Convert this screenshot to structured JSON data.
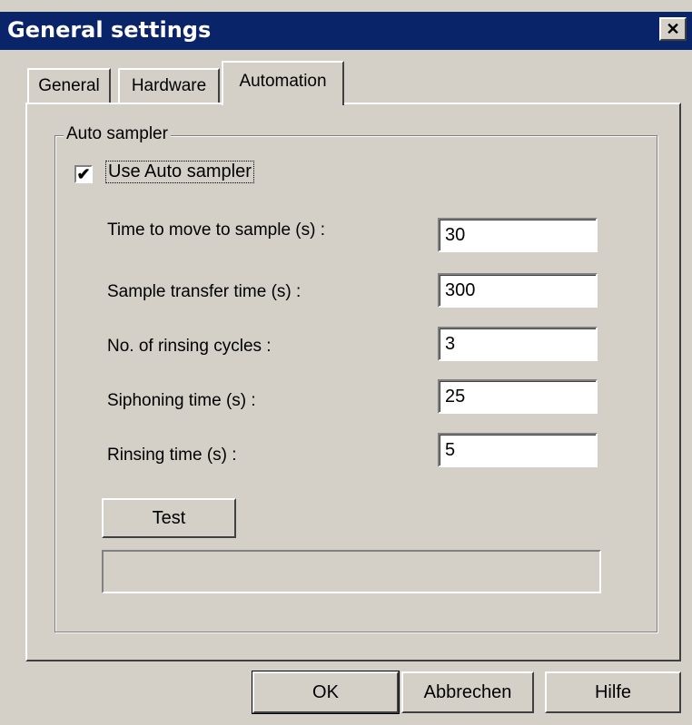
{
  "window": {
    "title": "General settings",
    "close_symbol": "✕",
    "close_icon": "close-icon"
  },
  "tabs": [
    {
      "label": "General",
      "active": false
    },
    {
      "label": "Hardware",
      "active": false
    },
    {
      "label": "Automation",
      "active": true
    }
  ],
  "auto_sampler": {
    "group_label": "Auto sampler",
    "use_checkbox": {
      "label": "Use Auto sampler",
      "checked": true,
      "mark": "✔"
    },
    "fields": [
      {
        "label": "Time to move to sample (s) :",
        "value": "30"
      },
      {
        "label": "Sample transfer time (s) :",
        "value": "300"
      },
      {
        "label": "No. of rinsing cycles :",
        "value": "3"
      },
      {
        "label": "Siphoning time (s) :",
        "value": "25"
      },
      {
        "label": "Rinsing time (s) :",
        "value": "5"
      }
    ],
    "test_button": "Test",
    "status_text": ""
  },
  "footer": {
    "ok": "OK",
    "cancel": "Abbrechen",
    "help": "Hilfe"
  },
  "colors": {
    "titlebar": "#0a246a",
    "face": "#d4d0c8"
  }
}
